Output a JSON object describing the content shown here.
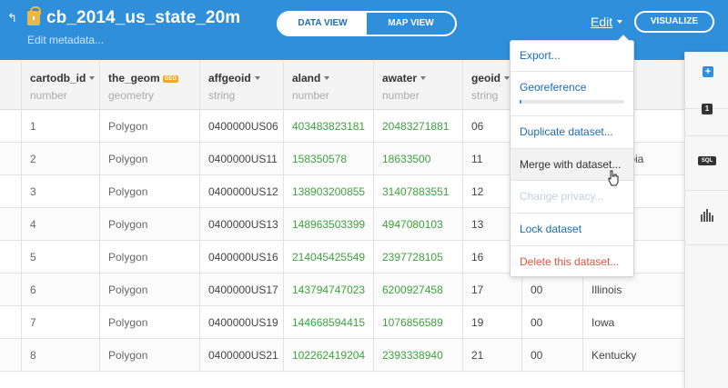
{
  "header": {
    "dataset_name": "cb_2014_us_state_20m",
    "edit_metadata": "Edit metadata...",
    "view_tabs": [
      "DATA VIEW",
      "MAP VIEW"
    ],
    "edit_label": "Edit",
    "visualize_label": "VISUALIZE"
  },
  "table": {
    "columns": [
      {
        "name": "cartodb_id",
        "type": "number"
      },
      {
        "name": "the_geom",
        "type": "geometry",
        "badge": "GEO"
      },
      {
        "name": "affgeoid",
        "type": "string"
      },
      {
        "name": "aland",
        "type": "number"
      },
      {
        "name": "awater",
        "type": "number"
      },
      {
        "name": "geoid",
        "type": "string"
      }
    ],
    "rows": [
      {
        "cartodb_id": "1",
        "the_geom": "Polygon",
        "affgeoid": "0400000US06",
        "aland": "403483823181",
        "awater": "20483271881",
        "geoid": "06",
        "c7": "",
        "c8": ""
      },
      {
        "cartodb_id": "2",
        "the_geom": "Polygon",
        "affgeoid": "0400000US11",
        "aland": "158350578",
        "awater": "18633500",
        "geoid": "11",
        "c7": "",
        "c8": "f Columbia"
      },
      {
        "cartodb_id": "3",
        "the_geom": "Polygon",
        "affgeoid": "0400000US12",
        "aland": "138903200855",
        "awater": "31407883551",
        "geoid": "12",
        "c7": "",
        "c8": ""
      },
      {
        "cartodb_id": "4",
        "the_geom": "Polygon",
        "affgeoid": "0400000US13",
        "aland": "148963503399",
        "awater": "4947080103",
        "geoid": "13",
        "c7": "",
        "c8": ""
      },
      {
        "cartodb_id": "5",
        "the_geom": "Polygon",
        "affgeoid": "0400000US16",
        "aland": "214045425549",
        "awater": "2397728105",
        "geoid": "16",
        "c7": "",
        "c8": ""
      },
      {
        "cartodb_id": "6",
        "the_geom": "Polygon",
        "affgeoid": "0400000US17",
        "aland": "143794747023",
        "awater": "6200927458",
        "geoid": "17",
        "c7": "00",
        "c8": "Illinois"
      },
      {
        "cartodb_id": "7",
        "the_geom": "Polygon",
        "affgeoid": "0400000US19",
        "aland": "144668594415",
        "awater": "1076856589",
        "geoid": "19",
        "c7": "00",
        "c8": "Iowa"
      },
      {
        "cartodb_id": "8",
        "the_geom": "Polygon",
        "affgeoid": "0400000US21",
        "aland": "102262419204",
        "awater": "2393338940",
        "geoid": "21",
        "c7": "00",
        "c8": "Kentucky"
      }
    ]
  },
  "dropdown": {
    "export": "Export...",
    "georeference": "Georeference",
    "georeference_progress": 0.02,
    "duplicate": "Duplicate dataset...",
    "merge": "Merge with dataset...",
    "change_privacy": "Change privacy...",
    "lock": "Lock dataset",
    "delete": "Delete this dataset..."
  },
  "right_panel": {
    "layer_count": "1",
    "sql_label": "SQL"
  },
  "colors": {
    "header_blue": "#2f8fdb",
    "number_green": "#3ca33c",
    "link_blue": "#1c6db6",
    "danger_red": "#e0553e",
    "geo_badge": "#f0a91e"
  },
  "icons": [
    "back-arrow-icon",
    "lock-icon",
    "caret-down-icon",
    "add-icon",
    "layer-count-icon",
    "sql-icon",
    "chart-bars-icon",
    "pointer-cursor-icon"
  ]
}
